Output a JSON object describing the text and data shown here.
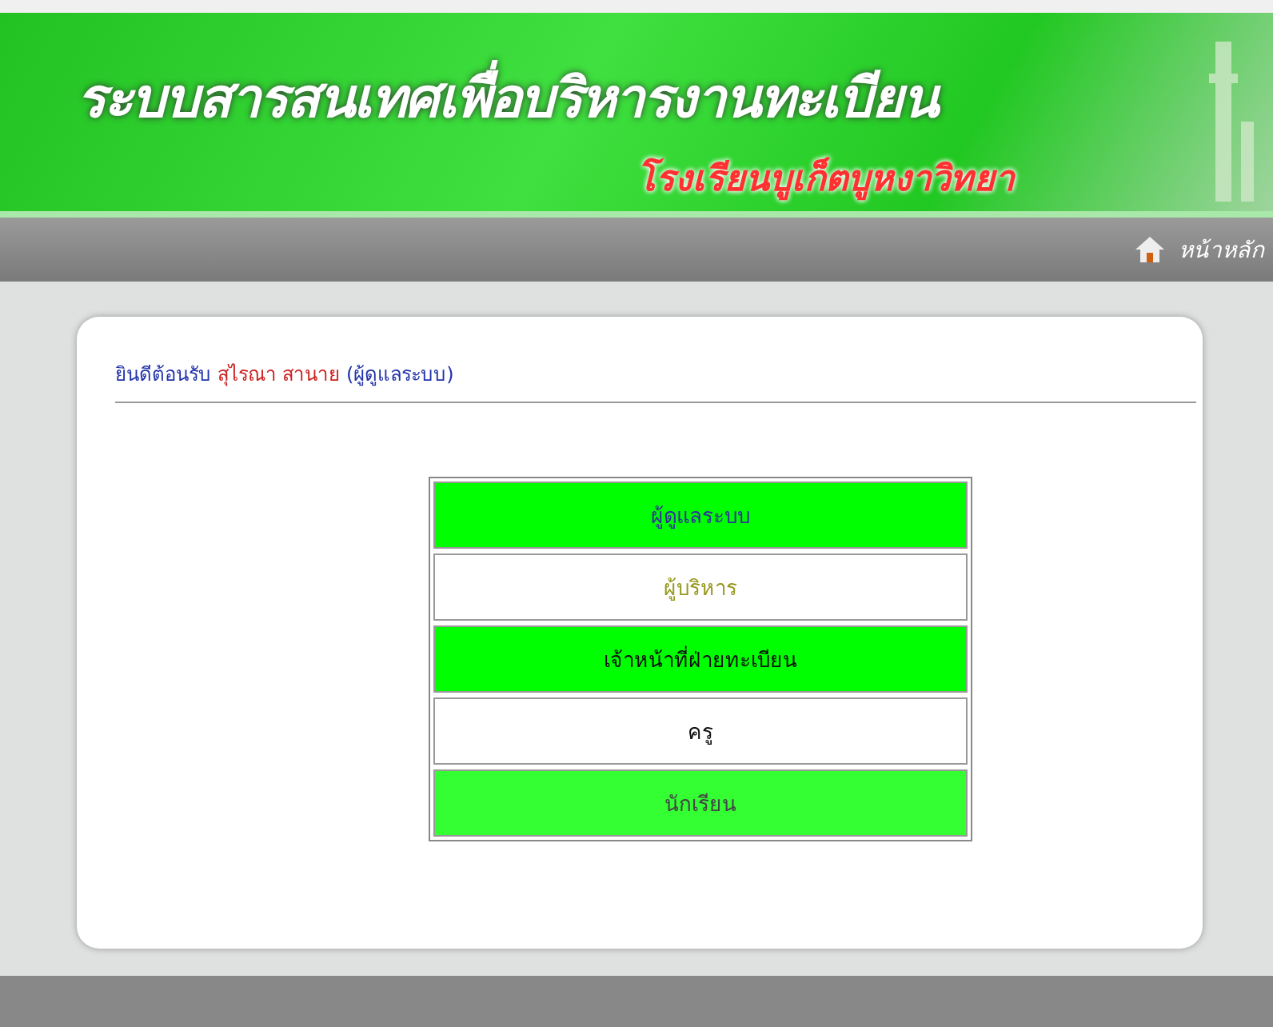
{
  "header": {
    "title": "ระบบสารสนเทศเพื่อบริหารงานทะเบียน",
    "subtitle": "โรงเรียนบูเก็ตบูหงาวิทยา"
  },
  "nav": {
    "home_link": "หน้าหลัก"
  },
  "welcome": {
    "greeting": "ยินดีต้อนรับ",
    "user_name": "สุไรณา สานาย",
    "role": "(ผู้ดูแลระบบ)"
  },
  "menu": [
    {
      "label": "ผู้ดูแลระบบ",
      "color": "#00ff00"
    },
    {
      "label": "ผู้บริหาร",
      "color": "#ffffff"
    },
    {
      "label": "เจ้าหน้าที่ฝ่ายทะเบียน",
      "color": "#00ff00"
    },
    {
      "label": "ครู",
      "color": "#ffffff"
    },
    {
      "label": "นักเรียน",
      "color": "#33ff33"
    }
  ]
}
